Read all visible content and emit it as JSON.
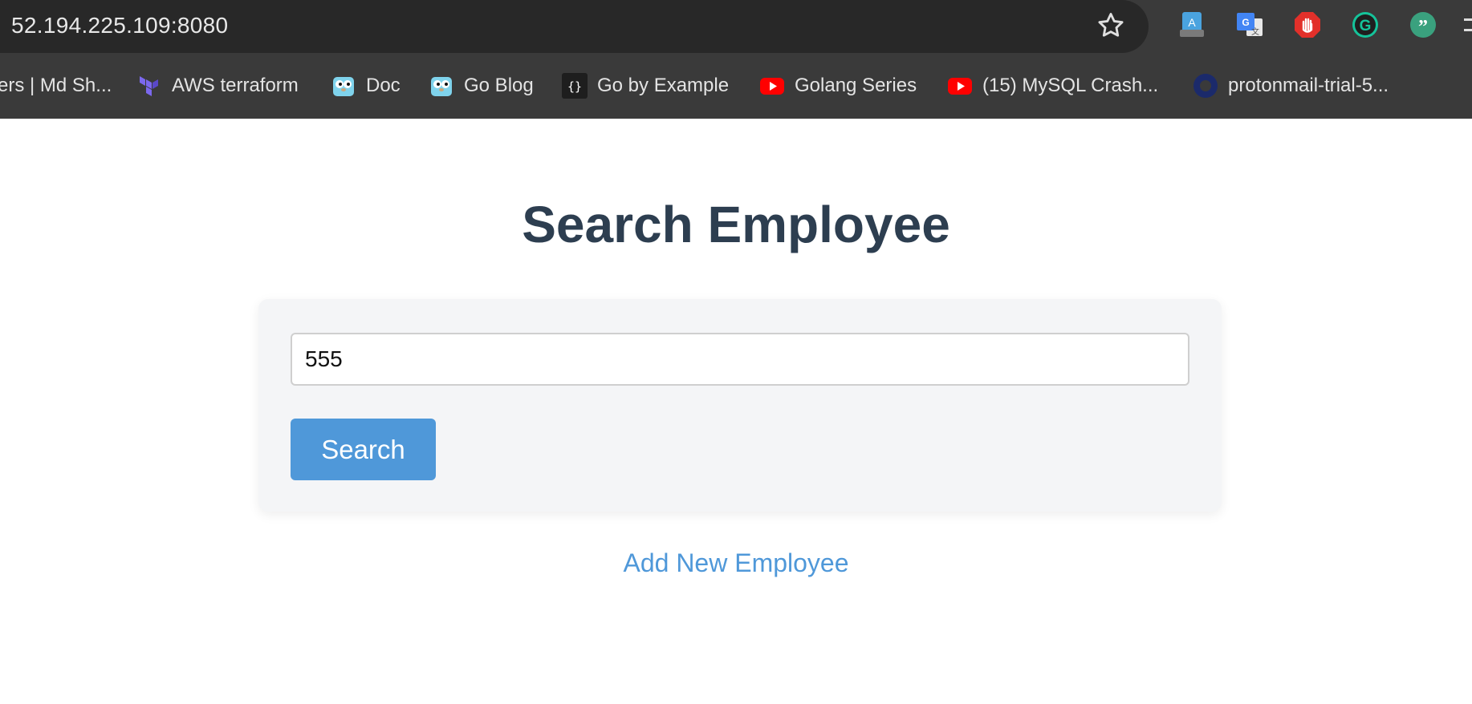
{
  "browser": {
    "url": "52.194.225.109:8080",
    "bookmarks": [
      {
        "label": "ers | Md Sh...",
        "icon": "partial-site-icon"
      },
      {
        "label": "AWS terraform",
        "icon": "terraform-icon"
      },
      {
        "label": "Doc",
        "icon": "gopher-icon"
      },
      {
        "label": "Go Blog",
        "icon": "gopher-icon"
      },
      {
        "label": "Go by Example",
        "icon": "braces-icon"
      },
      {
        "label": "Golang Series",
        "icon": "youtube-icon"
      },
      {
        "label": "(15) MySQL Crash...",
        "icon": "youtube-icon"
      },
      {
        "label": "protonmail-trial-5...",
        "icon": "proton-icon"
      }
    ],
    "extensions": [
      "translate-doc-icon",
      "google-translate-icon",
      "adblock-icon",
      "grammarly-icon",
      "quote-icon",
      "more-icon"
    ]
  },
  "page": {
    "title": "Search Employee",
    "search_value": "555",
    "search_button": "Search",
    "add_link": "Add New Employee"
  },
  "colors": {
    "heading": "#2d3e50",
    "accent": "#4f98d9",
    "card_bg": "#f4f5f7"
  }
}
